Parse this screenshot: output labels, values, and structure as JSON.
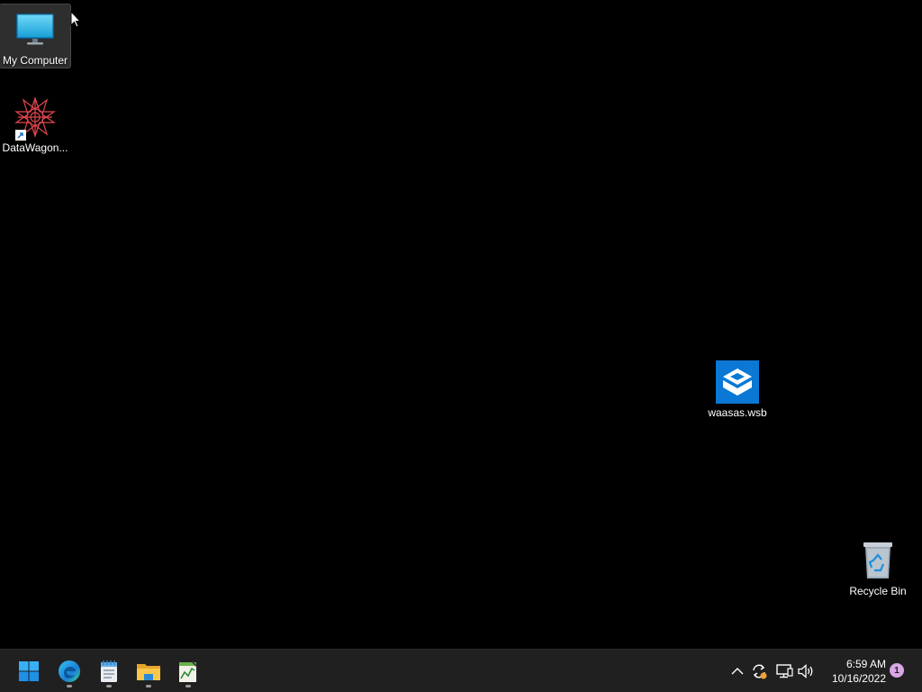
{
  "desktop": {
    "background_color": "#000000",
    "icons": [
      {
        "label": "My Computer",
        "icon": "monitor-icon",
        "selected": true
      },
      {
        "label": "DataWagon...",
        "icon": "datawagon-logo-icon",
        "shortcut": true
      },
      {
        "label": "waasas.wsb",
        "icon": "windows-sandbox-icon"
      },
      {
        "label": "Recycle Bin",
        "icon": "recycle-bin-icon"
      }
    ]
  },
  "taskbar": {
    "background_color": "#202020",
    "apps": [
      {
        "name": "start-button",
        "icon": "windows-logo-icon"
      },
      {
        "name": "edge",
        "icon": "edge-icon",
        "running": true
      },
      {
        "name": "notepad",
        "icon": "notepad-icon",
        "running": true
      },
      {
        "name": "file-explorer",
        "icon": "folder-icon",
        "running": true
      },
      {
        "name": "app",
        "icon": "chart-notepad-icon",
        "running": true
      }
    ],
    "tray": {
      "icons": [
        "chevron-up-icon",
        "sync-icon",
        "network-icon",
        "volume-icon"
      ],
      "time": "6:59 AM",
      "date": "10/16/2022",
      "notification_count": "1"
    }
  }
}
